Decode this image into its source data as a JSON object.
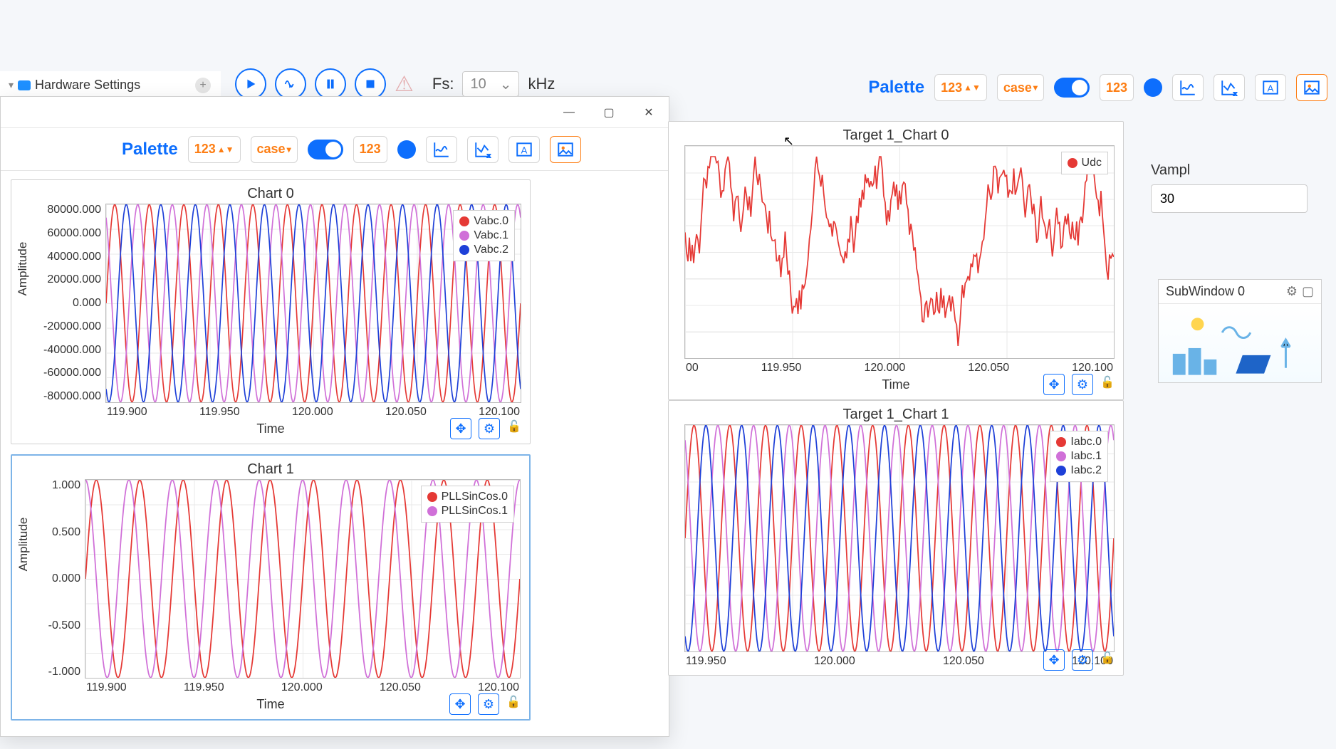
{
  "tree": {
    "item": "Hardware Settings"
  },
  "toolbar": {
    "fs_label": "Fs:",
    "fs_value": "10",
    "fs_unit": "kHz"
  },
  "palette": {
    "label": "Palette",
    "num_fmt": "123",
    "case": "case"
  },
  "inspector": {
    "label": "Vampl",
    "value": "30"
  },
  "subwindow": {
    "title": "SubWindow 0"
  },
  "chart_data": [
    {
      "id": "chart0",
      "title": "Chart 0",
      "type": "line",
      "xlabel": "Time",
      "ylabel": "Amplitude",
      "xlim": [
        119.9,
        120.1
      ],
      "xticks": [
        "119.900",
        "119.950",
        "120.000",
        "120.050",
        "120.100"
      ],
      "ylim": [
        -80000,
        80000
      ],
      "yticks": [
        "80000.000",
        "60000.000",
        "40000.000",
        "20000.000",
        "0.000",
        "-20000.000",
        "-40000.000",
        "-60000.000",
        "-80000.000"
      ],
      "series": [
        {
          "name": "Vabc.0",
          "color": "#e53935",
          "freq_hz": 60,
          "amplitude": 80000,
          "phase_deg": 0
        },
        {
          "name": "Vabc.1",
          "color": "#d070d8",
          "freq_hz": 60,
          "amplitude": 80000,
          "phase_deg": 120
        },
        {
          "name": "Vabc.2",
          "color": "#1e40d8",
          "freq_hz": 60,
          "amplitude": 80000,
          "phase_deg": 240
        }
      ]
    },
    {
      "id": "chart1",
      "title": "Chart 1",
      "type": "line",
      "xlabel": "Time",
      "ylabel": "Amplitude",
      "xlim": [
        119.9,
        120.1
      ],
      "xticks": [
        "119.900",
        "119.950",
        "120.000",
        "120.050",
        "120.100"
      ],
      "ylim": [
        -1,
        1
      ],
      "yticks": [
        "1.000",
        "0.500",
        "0.000",
        "-0.500",
        "-1.000"
      ],
      "series": [
        {
          "name": "PLLSinCos.0",
          "color": "#e53935",
          "freq_hz": 50,
          "amplitude": 1,
          "phase_deg": 0
        },
        {
          "name": "PLLSinCos.1",
          "color": "#d070d8",
          "freq_hz": 50,
          "amplitude": 1,
          "phase_deg": 90
        }
      ]
    },
    {
      "id": "t1c0",
      "title": "Target 1_Chart 0",
      "type": "line",
      "xlabel": "Time",
      "ylabel": "",
      "xlim": [
        119.9,
        120.1
      ],
      "xticks": [
        "00",
        "119.950",
        "120.000",
        "120.050",
        "120.100"
      ],
      "ylim": [
        0,
        1
      ],
      "yticks": [],
      "series": [
        {
          "name": "Udc",
          "color": "#e53935",
          "style": "noise"
        }
      ]
    },
    {
      "id": "t1c1",
      "title": "Target 1_Chart 1",
      "type": "line",
      "xlabel": "",
      "ylabel": "",
      "xlim": [
        119.9,
        120.1
      ],
      "xticks": [
        "119.950",
        "120.000",
        "120.050",
        "120.100"
      ],
      "ylim": [
        -1,
        1
      ],
      "yticks": [],
      "series": [
        {
          "name": "Iabc.0",
          "color": "#e53935",
          "freq_hz": 60,
          "amplitude": 1,
          "phase_deg": 0
        },
        {
          "name": "Iabc.1",
          "color": "#d070d8",
          "freq_hz": 60,
          "amplitude": 1,
          "phase_deg": 120
        },
        {
          "name": "Iabc.2",
          "color": "#1e40d8",
          "freq_hz": 60,
          "amplitude": 1,
          "phase_deg": 240
        }
      ]
    }
  ]
}
